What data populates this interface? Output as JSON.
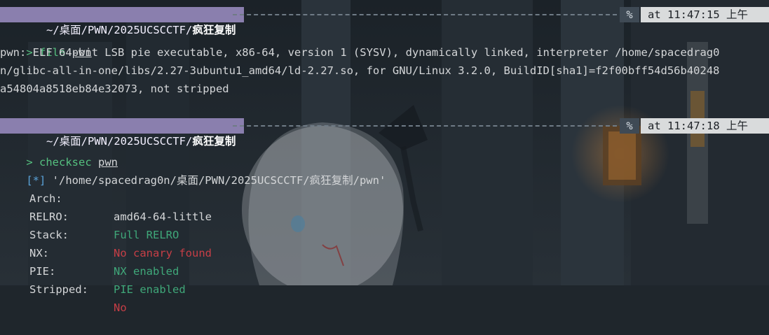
{
  "prompts": [
    {
      "path_prefix": "~/桌面/PWN/2025UCSCCTF/",
      "path_last": "疯狂复制",
      "indicator": "%",
      "time": "at 11:47:15 上午"
    },
    {
      "path_prefix": "~/桌面/PWN/2025UCSCCTF/",
      "path_last": "疯狂复制",
      "indicator": "%",
      "time": "at 11:47:18 上午"
    }
  ],
  "commands": [
    {
      "prompt": ">",
      "name": "file",
      "arg": "pwn"
    },
    {
      "prompt": ">",
      "name": "checksec",
      "arg": "pwn"
    }
  ],
  "file_output": [
    "pwn: ELF 64-bit LSB pie executable, x86-64, version 1 (SYSV), dynamically linked, interpreter /home/spacedrag0",
    "n/glibc-all-in-one/libs/2.27-3ubuntu1_amd64/ld-2.27.so, for GNU/Linux 3.2.0, BuildID[sha1]=f2f00bff54d56b40248",
    "a54804a8518eb84e32073, not stripped"
  ],
  "checksec": {
    "marker": "[*]",
    "path": "'/home/spacedrag0n/桌面/PWN/2025UCSCCTF/疯狂复制/pwn'",
    "rows": [
      {
        "label": "Arch:",
        "value": "amd64-64-little",
        "status": "normal"
      },
      {
        "label": "RELRO:",
        "value": "Full RELRO",
        "status": "good"
      },
      {
        "label": "Stack:",
        "value": "No canary found",
        "status": "bad"
      },
      {
        "label": "NX:",
        "value": "NX enabled",
        "status": "good"
      },
      {
        "label": "PIE:",
        "value": "PIE enabled",
        "status": "good"
      },
      {
        "label": "Stripped:",
        "value": "No",
        "status": "bad"
      }
    ]
  },
  "colors": {
    "path_bg": "#8a7fae",
    "time_bg": "#d9dbdc",
    "command": "#55c07f",
    "good": "#3fa779",
    "bad": "#c63e46",
    "marker": "#5aa2d8"
  }
}
